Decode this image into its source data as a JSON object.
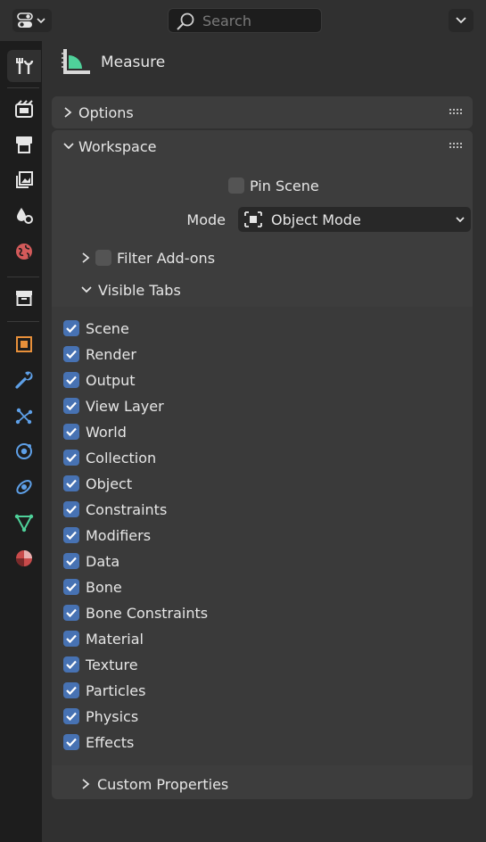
{
  "header": {
    "search_placeholder": "Search"
  },
  "tabs": [
    {
      "name": "tool",
      "icon": "tool-icon"
    },
    {
      "name": "render",
      "icon": "render-icon"
    },
    {
      "name": "output",
      "icon": "output-icon"
    },
    {
      "name": "view-layer",
      "icon": "view-layer-icon"
    },
    {
      "name": "scene",
      "icon": "scene-icon"
    },
    {
      "name": "world",
      "icon": "world-icon"
    },
    {
      "name": "collection",
      "icon": "collection-icon"
    },
    {
      "name": "object",
      "icon": "object-icon"
    },
    {
      "name": "modifiers",
      "icon": "wrench-icon"
    },
    {
      "name": "particles",
      "icon": "particles-icon"
    },
    {
      "name": "physics",
      "icon": "physics-icon"
    },
    {
      "name": "constraints",
      "icon": "constraints-icon"
    },
    {
      "name": "data",
      "icon": "mesh-data-icon"
    },
    {
      "name": "material",
      "icon": "material-icon"
    }
  ],
  "tool": {
    "title": "Measure",
    "title_icon": "measure-tool-icon"
  },
  "options_panel": {
    "title": "Options",
    "expanded": false
  },
  "workspace_panel": {
    "title": "Workspace",
    "expanded": true,
    "pin_scene_label": "Pin Scene",
    "pin_scene_checked": false,
    "mode_label": "Mode",
    "mode_value": "Object Mode",
    "filter_addons_label": "Filter Add-ons",
    "filter_addons_checked": false,
    "visible_tabs_label": "Visible Tabs",
    "visible_tabs": [
      {
        "label": "Scene",
        "checked": true
      },
      {
        "label": "Render",
        "checked": true
      },
      {
        "label": "Output",
        "checked": true
      },
      {
        "label": "View Layer",
        "checked": true
      },
      {
        "label": "World",
        "checked": true
      },
      {
        "label": "Collection",
        "checked": true
      },
      {
        "label": "Object",
        "checked": true
      },
      {
        "label": "Constraints",
        "checked": true
      },
      {
        "label": "Modifiers",
        "checked": true
      },
      {
        "label": "Data",
        "checked": true
      },
      {
        "label": "Bone",
        "checked": true
      },
      {
        "label": "Bone Constraints",
        "checked": true
      },
      {
        "label": "Material",
        "checked": true
      },
      {
        "label": "Texture",
        "checked": true
      },
      {
        "label": "Particles",
        "checked": true
      },
      {
        "label": "Physics",
        "checked": true
      },
      {
        "label": "Effects",
        "checked": true
      }
    ],
    "custom_properties_label": "Custom Properties"
  },
  "colors": {
    "checkbox_on": "#4772b3",
    "accent_green": "#4fd19a"
  }
}
